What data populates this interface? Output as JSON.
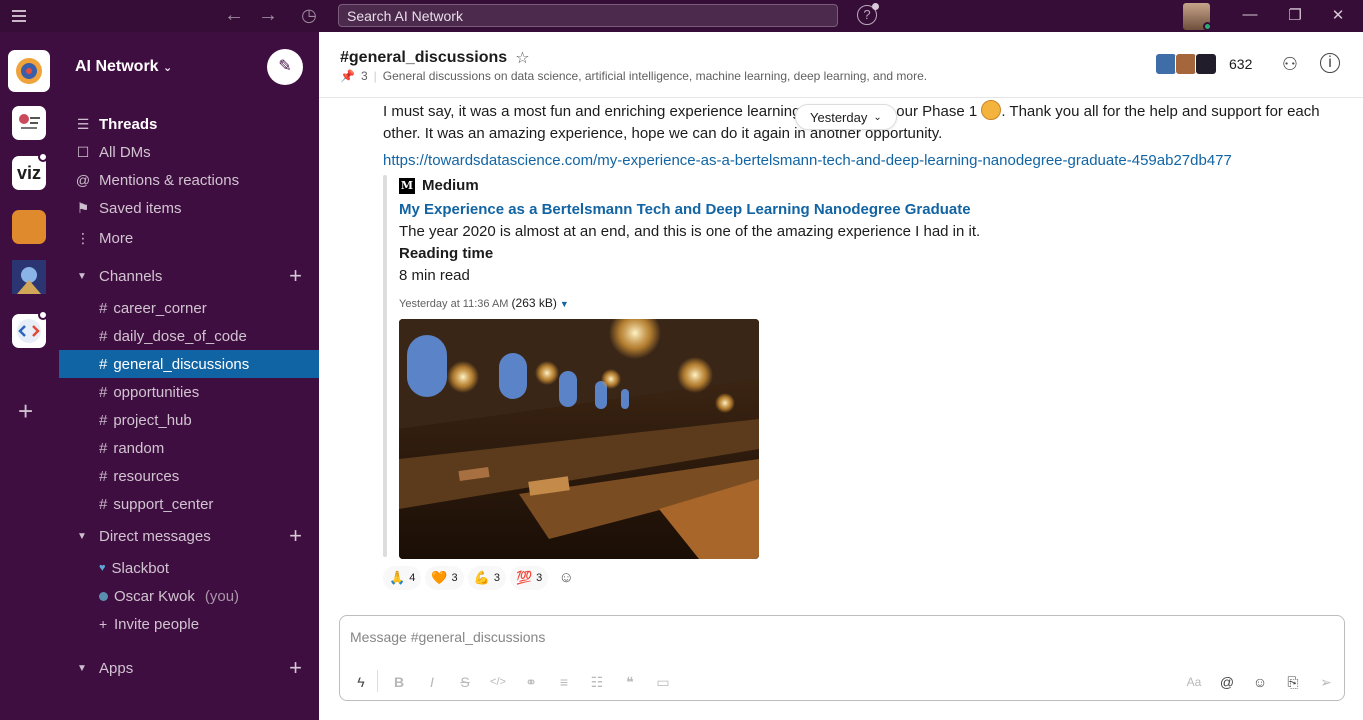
{
  "search": {
    "placeholder": "Search AI Network"
  },
  "workspace": {
    "name": "AI Network"
  },
  "sidebar": {
    "nav": [
      {
        "label": "Threads",
        "icon": "threads-icon"
      },
      {
        "label": "All DMs",
        "icon": "dms-icon"
      },
      {
        "label": "Mentions & reactions",
        "icon": "at-icon"
      },
      {
        "label": "Saved items",
        "icon": "bookmark-icon"
      },
      {
        "label": "More",
        "icon": "more-vertical-icon"
      }
    ],
    "channels_title": "Channels",
    "channels": [
      "career_corner",
      "daily_dose_of_code",
      "general_discussions",
      "opportunities",
      "project_hub",
      "random",
      "resources",
      "support_center"
    ],
    "active_channel": "general_discussions",
    "dm_title": "Direct messages",
    "dms": [
      {
        "name": "Slackbot",
        "suffix": ""
      },
      {
        "name": "Oscar Kwok",
        "suffix": "(you)"
      }
    ],
    "invite": "Invite people",
    "apps_title": "Apps"
  },
  "channel": {
    "title": "#general_discussions",
    "pins": "3",
    "topic": "General discussions on data science, artificial intelligence, machine learning, deep learning, and more.",
    "member_count": "632"
  },
  "message": {
    "text_before": "I must say, it was a most fun and enriching experience learning",
    "text_mid": "our Phase 1",
    "text_after": ". Thank you all for the help and support for each other. It was an amazing experience, hope we can do it again in another opportunity.",
    "link": "https://towardsdatascience.com/my-experience-as-a-bertelsmann-tech-and-deep-learning-nanodegree-graduate-459ab27db477",
    "divider": "Yesterday",
    "attachment": {
      "source": "Medium",
      "title": "My Experience as a Bertelsmann Tech and Deep Learning Nanodegree Graduate",
      "description": "The year 2020 is almost at an end, and this is one of the amazing experience I had in it.",
      "field_title": "Reading time",
      "field_value": "8 min read",
      "meta_time": "Yesterday at 11:36 AM",
      "meta_size": "(263 kB)"
    },
    "reactions": [
      {
        "emoji": "🙏",
        "count": "4"
      },
      {
        "emoji": "🧡",
        "count": "3"
      },
      {
        "emoji": "💪",
        "count": "3"
      },
      {
        "emoji": "💯",
        "count": "3"
      }
    ]
  },
  "composer": {
    "placeholder": "Message #general_discussions"
  },
  "colors": {
    "sidebar": "#3f0e40",
    "titlebar": "#350d36",
    "active": "#1164a3",
    "link": "#1264a3"
  }
}
